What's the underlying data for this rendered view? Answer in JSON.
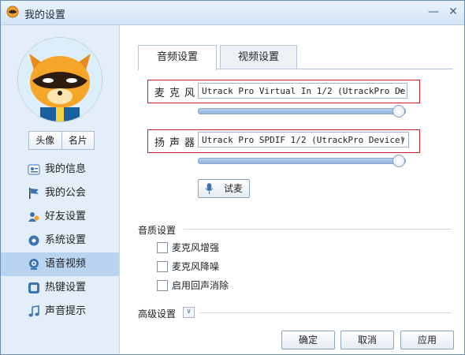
{
  "window": {
    "title": "我的设置",
    "close_label": "✕",
    "minimize_label": "—"
  },
  "sidebar": {
    "avatar_icon": "raccoon-mascot",
    "seg": {
      "avatar_label": "头像",
      "namecard_label": "名片"
    },
    "items": [
      {
        "label": "我的信息",
        "icon": "id-card-icon"
      },
      {
        "label": "我的公会",
        "icon": "flag-icon"
      },
      {
        "label": "好友设置",
        "icon": "friends-icon"
      },
      {
        "label": "系统设置",
        "icon": "gear-icon"
      },
      {
        "label": "语音视频",
        "icon": "webcam-icon",
        "active": true
      },
      {
        "label": "热键设置",
        "icon": "keyboard-icon"
      },
      {
        "label": "声音提示",
        "icon": "music-note-icon"
      }
    ]
  },
  "tabs": {
    "audio": "音频设置",
    "video": "视频设置"
  },
  "audio": {
    "mic_label": "麦克风",
    "mic_device": "Utrack Pro Virtual In  1/2 (UtrackPro De",
    "mic_volume": 0.99,
    "speaker_label": "扬声器",
    "speaker_device": "Utrack Pro SPDIF 1/2 (UtrackPro Device)",
    "speaker_volume": 0.99,
    "test_mic_label": "试麦"
  },
  "quality": {
    "title": "音质设置",
    "options": [
      {
        "label": "麦克风增强",
        "checked": false
      },
      {
        "label": "麦克风降噪",
        "checked": false
      },
      {
        "label": "启用回声消除",
        "checked": false
      }
    ]
  },
  "advanced": {
    "title": "高级设置"
  },
  "footer": {
    "ok": "确定",
    "cancel": "取消",
    "apply": "应用"
  },
  "colors": {
    "highlight_box": "#cc1e2b",
    "active_item": "#b8d4f1",
    "slider": "#8fb3dd"
  }
}
